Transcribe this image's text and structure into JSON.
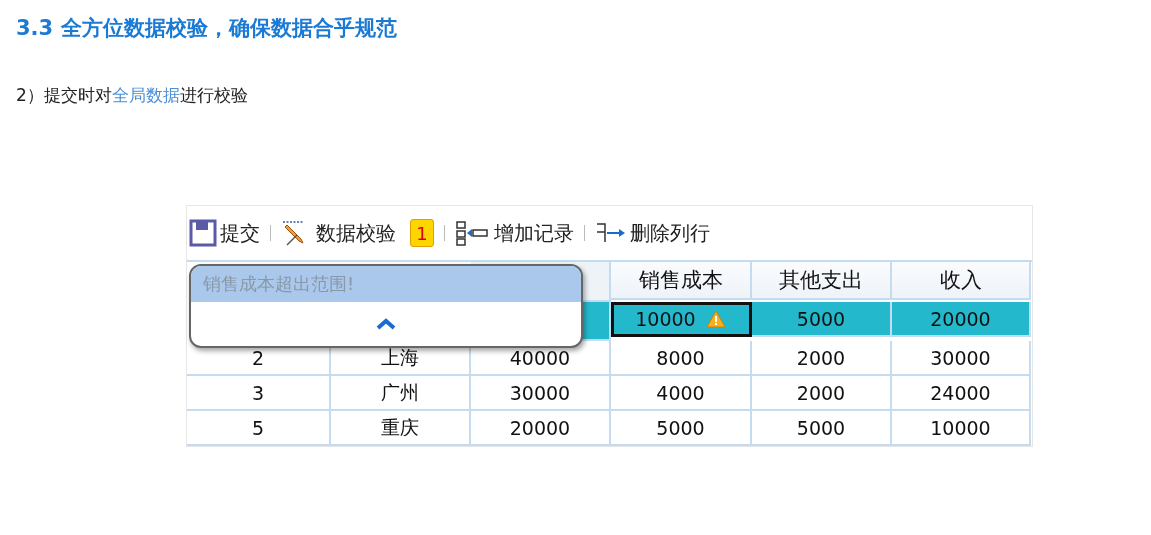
{
  "heading": "3.3 全方位数据校验，确保数据合乎规范",
  "subtitle": [
    {
      "text": "2）提交时对",
      "highlight": false
    },
    {
      "text": "全局数据",
      "highlight": true
    },
    {
      "text": "进行校验",
      "highlight": false
    }
  ],
  "toolbar": [
    {
      "kind": "save",
      "label": "提交"
    },
    {
      "kind": "validate",
      "label": "数据校验",
      "badge": "1"
    },
    {
      "kind": "add",
      "label": "增加记录"
    },
    {
      "kind": "delete",
      "label": "删除列行"
    }
  ],
  "table": {
    "columns": [
      "销售成本",
      "其他支出",
      "收入"
    ],
    "rows": [
      {
        "selected": true,
        "cells": [
          {
            "text": "10000",
            "flagged": true
          },
          {
            "text": "5000",
            "flagged": false
          },
          {
            "text": "20000",
            "flagged": false
          }
        ]
      },
      {
        "selected": false,
        "cells": [
          {
            "text": "2",
            "flagged": false
          },
          {
            "text": "上海",
            "flagged": false
          },
          {
            "text": "40000",
            "flagged": false
          },
          {
            "text": "8000",
            "flagged": false
          },
          {
            "text": "2000",
            "flagged": false
          },
          {
            "text": "30000",
            "flagged": false
          }
        ]
      },
      {
        "selected": false,
        "cells": [
          {
            "text": "3",
            "flagged": false
          },
          {
            "text": "广州",
            "flagged": false
          },
          {
            "text": "30000",
            "flagged": false
          },
          {
            "text": "4000",
            "flagged": false
          },
          {
            "text": "2000",
            "flagged": false
          },
          {
            "text": "24000",
            "flagged": false
          }
        ]
      },
      {
        "selected": false,
        "cells": [
          {
            "text": "5",
            "flagged": false
          },
          {
            "text": "重庆",
            "flagged": false
          },
          {
            "text": "20000",
            "flagged": false
          },
          {
            "text": "5000",
            "flagged": false
          },
          {
            "text": "5000",
            "flagged": false
          },
          {
            "text": "10000",
            "flagged": false
          }
        ]
      }
    ]
  },
  "popup": {
    "message": "销售成本超出范围!",
    "expanded": true
  }
}
